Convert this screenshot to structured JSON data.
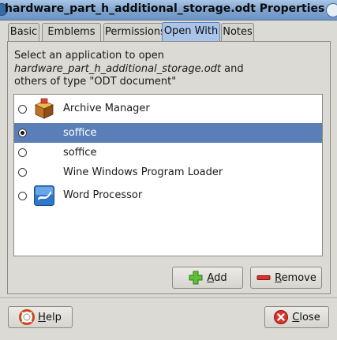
{
  "window": {
    "title": "hardware_part_h_additional_storage.odt Properties"
  },
  "tabs": [
    {
      "label": "Basic",
      "active": false
    },
    {
      "label": "Emblems",
      "active": false
    },
    {
      "label": "Permissions",
      "active": false
    },
    {
      "label": "Open With",
      "active": true
    },
    {
      "label": "Notes",
      "active": false
    }
  ],
  "intro": {
    "line1": "Select an application to open",
    "filename": "hardware_part_h_additional_storage.odt",
    "and": " and",
    "line3": "others of type \"ODT document\""
  },
  "apps": [
    {
      "label": "Archive Manager",
      "icon": "archive-manager-icon",
      "selected": false,
      "checked": false
    },
    {
      "label": "soffice",
      "icon": "",
      "selected": true,
      "checked": true
    },
    {
      "label": "soffice",
      "icon": "",
      "selected": false,
      "checked": false
    },
    {
      "label": "Wine Windows Program Loader",
      "icon": "",
      "selected": false,
      "checked": false
    },
    {
      "label": "Word Processor",
      "icon": "word-processor-icon",
      "selected": false,
      "checked": false
    }
  ],
  "buttons": {
    "add": {
      "label": "Add",
      "mnemonic": "A",
      "rest": "dd",
      "icon": "add-icon"
    },
    "remove": {
      "label": "Remove",
      "mnemonic": "R",
      "rest": "emove",
      "icon": "remove-icon"
    },
    "help": {
      "label": "Help",
      "mnemonic": "H",
      "rest": "elp",
      "icon": "help-icon"
    },
    "close": {
      "label": "Close",
      "mnemonic": "C",
      "rest": "lose",
      "icon": "close-icon"
    }
  },
  "colors": {
    "accent": "#5a7fb8",
    "tab_active": "#a9c4e8",
    "background": "#dcdad5"
  }
}
